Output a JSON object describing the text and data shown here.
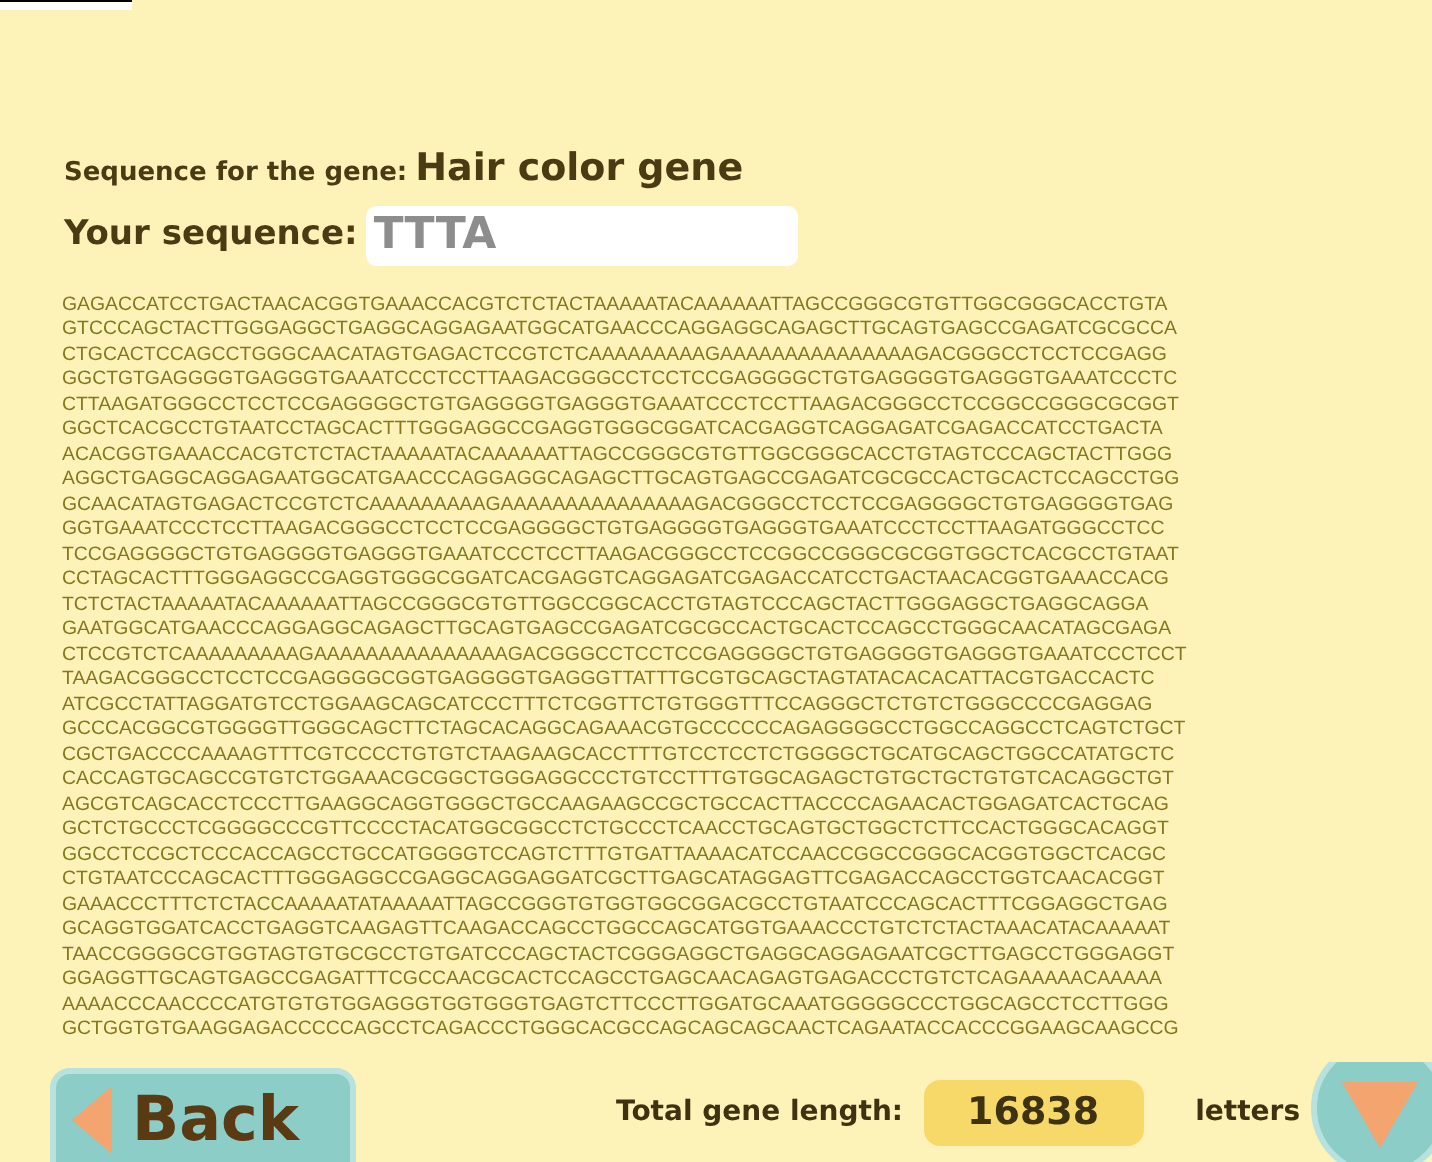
{
  "gene": {
    "label": "Sequence for the gene:",
    "name": "Hair color gene"
  },
  "your_sequence": {
    "label": "Your sequence:",
    "value": "TTTA"
  },
  "sequence_lines": [
    "GAGACCATCCTGACTAACACGGTGAAACCACGTCTCTACTAAAAATACAAAAAATTAGCCGGGCGTGTTGGCGGGCACCTGTA",
    "GTCCCAGCTACTTGGGAGGCTGAGGCAGGAGAATGGCATGAACCCAGGAGGCAGAGCTTGCAGTGAGCCGAGATCGCGCCA",
    "CTGCACTCCAGCCTGGGCAACATAGTGAGACTCCGTCTCAAAAAAAAAGAAAAAAAAAAAAAAAGACGGGCCTCCTCCGAGG",
    "GGCTGTGAGGGGTGAGGGTGAAATCCCTCCTTAAGACGGGCCTCCTCCGAGGGGCTGTGAGGGGTGAGGGTGAAATCCCTC",
    "CTTAAGATGGGCCTCCTCCGAGGGGCTGTGAGGGGTGAGGGTGAAATCCCTCCTTAAGACGGGCCTCCGGCCGGGCGCGGT",
    "GGCTCACGCCTGTAATCCTAGCACTTTGGGAGGCCGAGGTGGGCGGATCACGAGGTCAGGAGATCGAGACCATCCTGACTA",
    "ACACGGTGAAACCACGTCTCTACTAAAAATACAAAAAATTAGCCGGGCGTGTTGGCGGGCACCTGTAGTCCCAGCTACTTGGG",
    "AGGCTGAGGCAGGAGAATGGCATGAACCCAGGAGGCAGAGCTTGCAGTGAGCCGAGATCGCGCCACTGCACTCCAGCCTGG",
    "GCAACATAGTGAGACTCCGTCTCAAAAAAAAAGAAAAAAAAAAAAAAAGACGGGCCTCCTCCGAGGGGCTGTGAGGGGTGAG",
    "GGTGAAATCCCTCCTTAAGACGGGCCTCCTCCGAGGGGCTGTGAGGGGTGAGGGTGAAATCCCTCCTTAAGATGGGCCTCC",
    "TCCGAGGGGCTGTGAGGGGTGAGGGTGAAATCCCTCCTTAAGACGGGCCTCCGGCCGGGCGCGGTGGCTCACGCCTGTAAT",
    "CCTAGCACTTTGGGAGGCCGAGGTGGGCGGATCACGAGGTCAGGAGATCGAGACCATCCTGACTAACACGGTGAAACCACG",
    "TCTCTACTAAAAATACAAAAAATTAGCCGGGCGTGTTGGCCGGCACCTGTAGTCCCAGCTACTTGGGAGGCTGAGGCAGGA",
    "GAATGGCATGAACCCAGGAGGCAGAGCTTGCAGTGAGCCGAGATCGCGCCACTGCACTCCAGCCTGGGCAACATAGCGAGA",
    "CTCCGTCTCAAAAAAAAAGAAAAAAAAAAAAAAAGACGGGCCTCCTCCGAGGGGCTGTGAGGGGTGAGGGTGAAATCCCTCCT",
    "TAAGACGGGCCTCCTCCGAGGGGCGGTGAGGGGTGAGGGTTATTTGCGTGCAGCTAGTATACACACATTACGTGACCACTC",
    "ATCGCCTATTAGGATGTCCTGGAAGCAGCATCCCTTTCTCGGTTCTGTGGGTTTCCAGGGCTCTGTCTGGGCCCCGAGGAG",
    "GCCCACGGCGTGGGGTTGGGCAGCTTCTAGCACAGGCAGAAACGTGCCCCCCAGAGGGGCCTGGCCAGGCCTCAGTCTGCT",
    "CGCTGACCCCAAAAGTTTCGTCCCCTGTGTCTAAGAAGCACCTTTGTCCTCCTCTGGGGCTGCATGCAGCTGGCCATATGCTC",
    "CACCAGTGCAGCCGTGTCTGGAAACGCGGCTGGGAGGCCCTGTCCTTTGTGGCAGAGCTGTGCTGCTGTGTCACAGGCTGT",
    "AGCGTCAGCACCTCCCTTGAAGGCAGGTGGGCTGCCAAGAAGCCGCTGCCACTTACCCCAGAACACTGGAGATCACTGCAG",
    "GCTCTGCCCTCGGGGCCCGTTCCCCTACATGGCGGCCTCTGCCCTCAACCTGCAGTGCTGGCTCTTCCACTGGGCACAGGT",
    "GGCCTCCGCTCCCACCAGCCTGCCATGGGGTCCAGTCTTTGTGATTAAAACATCCAACCGGCCGGGCACGGTGGCTCACGC",
    "CTGTAATCCCAGCACTTTGGGAGGCCGAGGCAGGAGGATCGCTTGAGCATAGGAGTTCGAGACCAGCCTGGTCAACACGGT",
    "GAAACCCTTTCTCTACCAAAAATATAAAAATTAGCCGGGTGTGGTGGCGGACGCCTGTAATCCCAGCACTTTCGGAGGCTGAG",
    "GCAGGTGGATCACCTGAGGTCAAGAGTTCAAGACCAGCCTGGCCAGCATGGTGAAACCCTGTCTCTACTAAACATACAAAAAT",
    "TAACCGGGGCGTGGTAGTGTGCGCCTGTGATCCCAGCTACTCGGGAGGCTGAGGCAGGAGAATCGCTTGAGCCTGGGAGGT",
    "GGAGGTTGCAGTGAGCCGAGATTTCGCCAACGCACTCCAGCCTGAGCAACAGAGTGAGACCCTGTCTCAGAAAAACAAAAA",
    "AAAACCCAACCCCATGTGTGTGGAGGGTGGTGGGTGAGTCTTCCCTTGGATGCAAATGGGGGCCCTGGCAGCCTCCTTGGG",
    "GCTGGTGTGAAGGAGACCCCCAGCCTCAGACCCTGGGCACGCCAGCAGCAGCAACTCAGAATACCACCCGGAAGCAAGCCG"
  ],
  "back_button": {
    "label": "Back"
  },
  "total": {
    "label": "Total gene length:",
    "value": "16838",
    "unit": "letters"
  }
}
